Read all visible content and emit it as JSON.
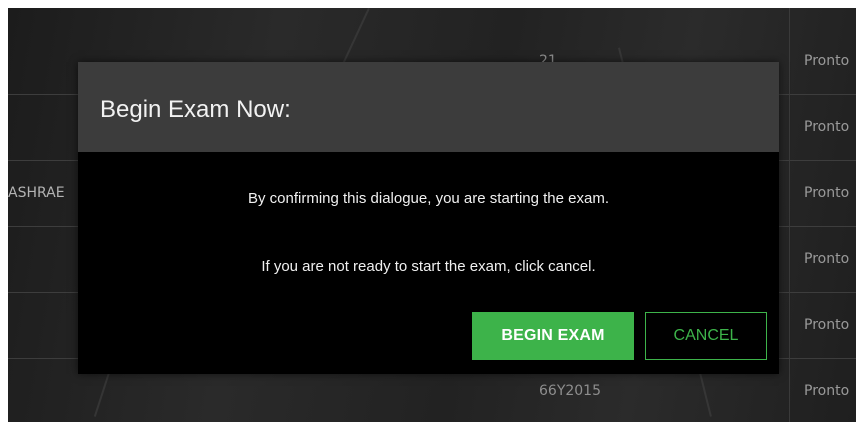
{
  "background_table": {
    "rows": [
      {
        "left": "",
        "mid": "21",
        "right": "Pronto"
      },
      {
        "left": "",
        "mid": "",
        "right": "Pronto"
      },
      {
        "left": "ASHRAE",
        "mid": "",
        "right": "Pronto"
      },
      {
        "left": "",
        "mid": "",
        "right": "Pronto"
      },
      {
        "left": "",
        "mid": "",
        "right": "Pronto"
      },
      {
        "left": "",
        "mid": "66Y2015",
        "right": "Pronto"
      }
    ]
  },
  "dialog": {
    "title": "Begin Exam Now:",
    "line1": "By confirming this dialogue, you are starting the exam.",
    "line2": "If you are not ready to start the exam, click cancel.",
    "begin_label": "BEGIN EXAM",
    "cancel_label": "CANCEL"
  },
  "colors": {
    "accent_green": "#3db34a",
    "dialog_bg": "#000000",
    "header_bg": "#3c3c3c"
  }
}
